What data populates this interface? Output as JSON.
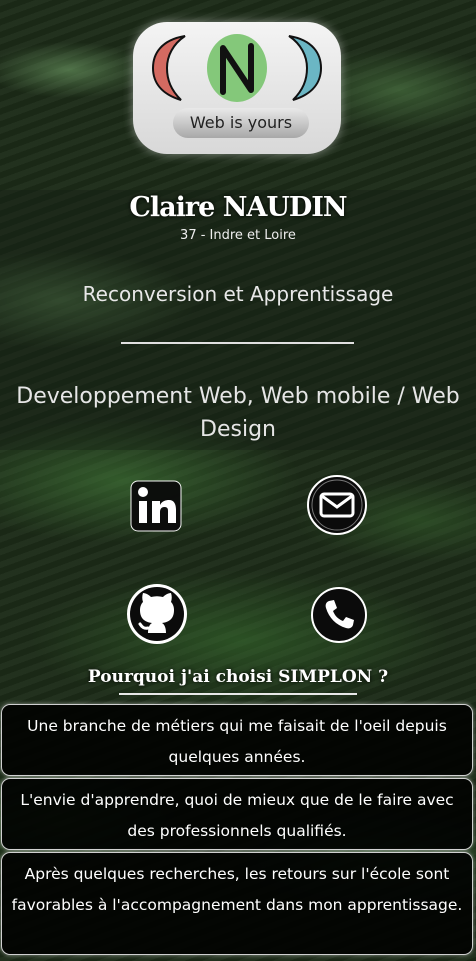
{
  "logo": {
    "tagline": "Web is yours",
    "colors": {
      "left_arc": "#d46a61",
      "center": "#84c87a",
      "right_arc": "#6bb6c4"
    }
  },
  "profile": {
    "name": "Claire NAUDIN",
    "location": "37 - Indre et Loire",
    "subtitle": "Reconversion et Apprentissage",
    "field": "Developpement Web, Web mobile / Web Design"
  },
  "contacts": [
    {
      "icon": "linkedin-icon"
    },
    {
      "icon": "mail-icon"
    },
    {
      "icon": "github-icon"
    },
    {
      "icon": "phone-icon"
    }
  ],
  "why_section": {
    "title": "Pourquoi j'ai choisi SIMPLON ?",
    "reasons": [
      "Une branche de métiers qui me faisait de l'oeil depuis quelques années.",
      "L'envie d'apprendre, quoi de mieux que de le faire avec des professionnels qualifiés.",
      "Après quelques recherches, les retours sur l'école sont favorables à l'accompagnement dans mon apprentissage."
    ]
  }
}
